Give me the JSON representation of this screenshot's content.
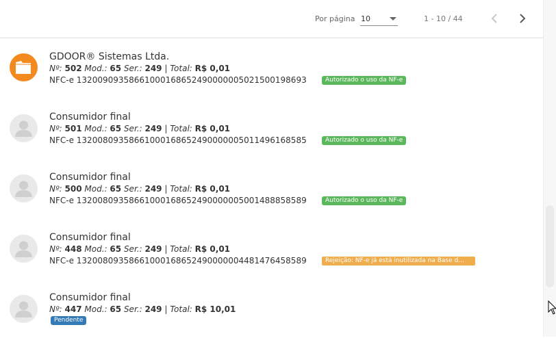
{
  "pager": {
    "per_page_label": "Por página",
    "per_page_value": "10",
    "range": "1 - 10 / 44",
    "prev_icon": "chevron-left-icon",
    "next_icon": "chevron-right-icon"
  },
  "items": [
    {
      "title": "GDOOR® Sistemas Ltda.",
      "number_label": "Nº:",
      "number": "502",
      "model_label": "Mod.:",
      "model": "65",
      "series_label": "Ser.:",
      "series": "249",
      "total_label": "Total:",
      "total": "R$ 0,01",
      "key": "NFC-e 13200909358661000168652490000005021500198693",
      "status": "Autorizado o uso da NF-e",
      "status_color": "#5cb85c",
      "avatar_icon": "folder-icon"
    },
    {
      "title": "Consumidor final",
      "number_label": "Nº:",
      "number": "501",
      "model_label": "Mod.:",
      "model": "65",
      "series_label": "Ser.:",
      "series": "249",
      "total_label": "Total:",
      "total": "R$ 0,01",
      "key": "NFC-e 13200809358661000168652490000005011496168585",
      "status": "Autorizado o uso da NF-e",
      "status_color": "#5cb85c",
      "avatar_icon": "person-icon"
    },
    {
      "title": "Consumidor final",
      "number_label": "Nº:",
      "number": "500",
      "model_label": "Mod.:",
      "model": "65",
      "series_label": "Ser.:",
      "series": "249",
      "total_label": "Total:",
      "total": "R$ 0,01",
      "key": "NFC-e 13200809358661000168652490000005001488858589",
      "status": "Autorizado o uso da NF-e",
      "status_color": "#5cb85c",
      "avatar_icon": "person-icon"
    },
    {
      "title": "Consumidor final",
      "number_label": "Nº:",
      "number": "448",
      "model_label": "Mod.:",
      "model": "65",
      "series_label": "Ser.:",
      "series": "249",
      "total_label": "Total:",
      "total": "R$ 0,01",
      "key": "NFC-e 13200809358661000168652490000004481476458589",
      "status": "Rejeição: NF-e já está inutilizada na Base d...",
      "status_color": "#f0ad4e",
      "avatar_icon": "person-icon"
    },
    {
      "title": "Consumidor final",
      "number_label": "Nº:",
      "number": "447",
      "model_label": "Mod.:",
      "model": "65",
      "series_label": "Ser.:",
      "series": "249",
      "total_label": "Total:",
      "total": "R$ 10,01",
      "status": "Pendente",
      "status_color": "#337ab7",
      "avatar_icon": "person-icon"
    }
  ]
}
